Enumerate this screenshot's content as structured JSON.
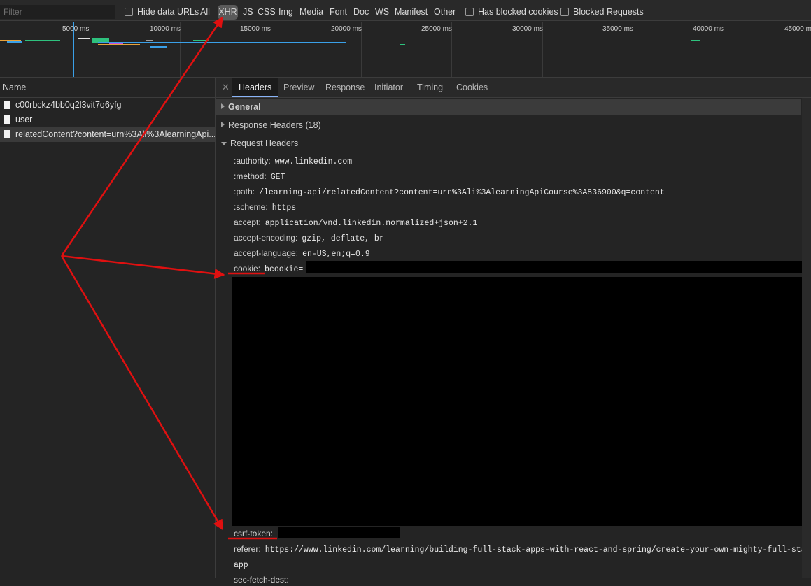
{
  "filterbar": {
    "filter_placeholder": "Filter",
    "hide_data_urls": "Hide data URLs",
    "types": [
      "All",
      "XHR",
      "JS",
      "CSS",
      "Img",
      "Media",
      "Font",
      "Doc",
      "WS",
      "Manifest",
      "Other"
    ],
    "selected_type": "XHR",
    "has_blocked_cookies": "Has blocked cookies",
    "blocked_requests": "Blocked Requests"
  },
  "overview": {
    "ticks": [
      "5000 ms",
      "10000 ms",
      "15000 ms",
      "20000 ms",
      "25000 ms",
      "30000 ms",
      "35000 ms",
      "40000 ms",
      "45000 m"
    ]
  },
  "requests": {
    "header": "Name",
    "items": [
      {
        "name": "c00rbckz4bb0q2l3vit7q6yfg"
      },
      {
        "name": "user"
      },
      {
        "name": "relatedContent?content=urn%3Ali%3AlearningApi..."
      }
    ]
  },
  "details": {
    "tabs": [
      "Headers",
      "Preview",
      "Response",
      "Initiator",
      "Timing",
      "Cookies"
    ],
    "active_tab": "Headers",
    "sections": {
      "general": "General",
      "response_headers": "Response Headers (18)",
      "request_headers": "Request Headers"
    },
    "request_headers": [
      {
        "key": ":authority:",
        "value": "www.linkedin.com"
      },
      {
        "key": ":method:",
        "value": "GET"
      },
      {
        "key": ":path:",
        "value": "/learning-api/relatedContent?content=urn%3Ali%3AlearningApiCourse%3A836900&q=content"
      },
      {
        "key": ":scheme:",
        "value": "https"
      },
      {
        "key": "accept:",
        "value": "application/vnd.linkedin.normalized+json+2.1"
      },
      {
        "key": "accept-encoding:",
        "value": "gzip, deflate, br"
      },
      {
        "key": "accept-language:",
        "value": "en-US,en;q=0.9"
      },
      {
        "key": "cookie:",
        "value": "bcookie="
      }
    ],
    "csrf_key": "csrf-token:",
    "referer_key": "referer:",
    "referer_value": "https://www.linkedin.com/learning/building-full-stack-apps-with-react-and-spring/create-your-own-mighty-full-stack-",
    "referer_value_cont": "app",
    "partial_next_key": "sec-fetch-dest:"
  },
  "colors": {
    "annotation": "#e01010",
    "active_tab_underline": "#8ab4f8",
    "timeline_blue": "#3aa0e8",
    "timeline_green": "#2ec27e",
    "timeline_red": "#e04040"
  }
}
